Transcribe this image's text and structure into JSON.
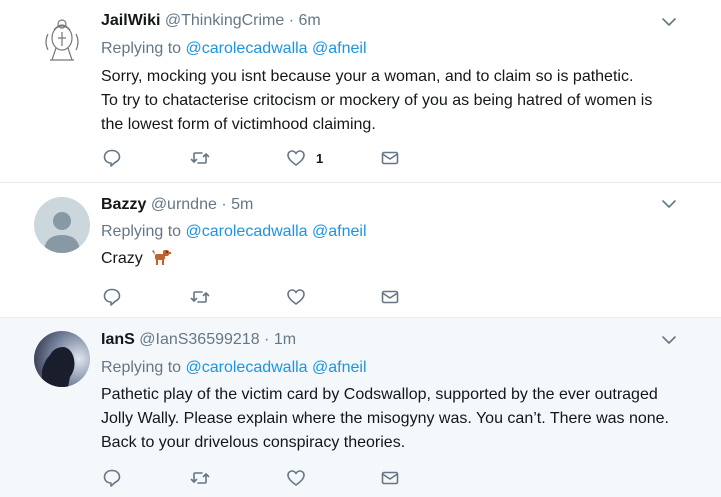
{
  "colors": {
    "link": "#1b95e0",
    "muted": "#657786",
    "text": "#14171a",
    "highlight_bg": "#f5f8fa",
    "divider": "#e6ecf0"
  },
  "tweets": [
    {
      "name": "JailWiki",
      "handle": "@ThinkingCrime",
      "separator": "·",
      "time": "6m",
      "replying_prefix": "Replying to",
      "mentions": [
        "@carolecadwalla",
        "@afneil"
      ],
      "text_lines": [
        "Sorry, mocking you isnt because your a woman, and to claim so is pathetic.",
        "To try to chatacterise critocism or mockery of you as being hatred of women is",
        "the lowest form of victimhood claiming."
      ],
      "avatar_icon": "crest-icon",
      "like_count": "1"
    },
    {
      "name": "Bazzy",
      "handle": "@urndne",
      "separator": "·",
      "time": "5m",
      "replying_prefix": "Replying to",
      "mentions": [
        "@carolecadwalla",
        "@afneil"
      ],
      "text_lines": [
        "Crazy"
      ],
      "emoji": "dog-emoji",
      "avatar_icon": "default-profile-icon",
      "like_count": ""
    },
    {
      "name": "IanS",
      "handle": "@IanS36599218",
      "separator": "·",
      "time": "1m",
      "replying_prefix": "Replying to",
      "mentions": [
        "@carolecadwalla",
        "@afneil"
      ],
      "text_lines": [
        "Pathetic play of the victim card by Codswallop, supported by the ever outraged",
        "Jolly Wally. Please explain where the misogyny was. You can’t. There was none.",
        "Back to your drivelous conspiracy theories."
      ],
      "avatar_icon": "silhouette-photo-icon",
      "like_count": ""
    }
  ]
}
